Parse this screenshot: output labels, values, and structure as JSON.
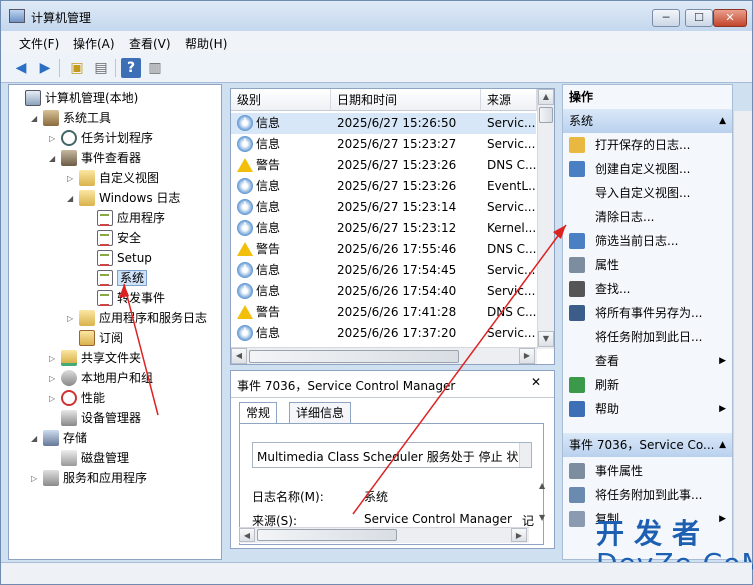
{
  "window": {
    "title": "计算机管理",
    "min": "─",
    "max": "☐",
    "close": "✕"
  },
  "menu": [
    "文件(F)",
    "操作(A)",
    "查看(V)",
    "帮助(H)"
  ],
  "tree": [
    {
      "label": "计算机管理(本地)",
      "indent": 0,
      "exp": "",
      "icon": "computer"
    },
    {
      "label": "系统工具",
      "indent": 1,
      "exp": "◢",
      "icon": "tools"
    },
    {
      "label": "任务计划程序",
      "indent": 2,
      "exp": "▷",
      "icon": "clock"
    },
    {
      "label": "事件查看器",
      "indent": 2,
      "exp": "◢",
      "icon": "event"
    },
    {
      "label": "自定义视图",
      "indent": 3,
      "exp": "▷",
      "icon": "folder"
    },
    {
      "label": "Windows 日志",
      "indent": 3,
      "exp": "◢",
      "icon": "folder"
    },
    {
      "label": "应用程序",
      "indent": 4,
      "exp": "",
      "icon": "log"
    },
    {
      "label": "安全",
      "indent": 4,
      "exp": "",
      "icon": "log"
    },
    {
      "label": "Setup",
      "indent": 4,
      "exp": "",
      "icon": "log"
    },
    {
      "label": "系统",
      "indent": 4,
      "exp": "",
      "icon": "log",
      "selected": true
    },
    {
      "label": "转发事件",
      "indent": 4,
      "exp": "",
      "icon": "log"
    },
    {
      "label": "应用程序和服务日志",
      "indent": 3,
      "exp": "▷",
      "icon": "folder"
    },
    {
      "label": "订阅",
      "indent": 3,
      "exp": "",
      "icon": "subscription"
    },
    {
      "label": "共享文件夹",
      "indent": 2,
      "exp": "▷",
      "icon": "share"
    },
    {
      "label": "本地用户和组",
      "indent": 2,
      "exp": "▷",
      "icon": "users"
    },
    {
      "label": "性能",
      "indent": 2,
      "exp": "▷",
      "icon": "perf"
    },
    {
      "label": "设备管理器",
      "indent": 2,
      "exp": "",
      "icon": "device"
    },
    {
      "label": "存储",
      "indent": 1,
      "exp": "◢",
      "icon": "storage"
    },
    {
      "label": "磁盘管理",
      "indent": 2,
      "exp": "",
      "icon": "disk"
    },
    {
      "label": "服务和应用程序",
      "indent": 1,
      "exp": "▷",
      "icon": "service"
    }
  ],
  "events": {
    "columns": [
      "级别",
      "日期和时间",
      "来源"
    ],
    "rows": [
      {
        "level": "info",
        "level_text": "信息",
        "date": "2025/6/27 15:26:50",
        "source": "Servic...",
        "selected": true
      },
      {
        "level": "info",
        "level_text": "信息",
        "date": "2025/6/27 15:23:27",
        "source": "Servic..."
      },
      {
        "level": "warn",
        "level_text": "警告",
        "date": "2025/6/27 15:23:26",
        "source": "DNS C..."
      },
      {
        "level": "info",
        "level_text": "信息",
        "date": "2025/6/27 15:23:26",
        "source": "EventL..."
      },
      {
        "level": "info",
        "level_text": "信息",
        "date": "2025/6/27 15:23:14",
        "source": "Servic..."
      },
      {
        "level": "info",
        "level_text": "信息",
        "date": "2025/6/27 15:23:12",
        "source": "Kernel..."
      },
      {
        "level": "warn",
        "level_text": "警告",
        "date": "2025/6/26 17:55:46",
        "source": "DNS C..."
      },
      {
        "level": "info",
        "level_text": "信息",
        "date": "2025/6/26 17:54:45",
        "source": "Servic..."
      },
      {
        "level": "info",
        "level_text": "信息",
        "date": "2025/6/26 17:54:40",
        "source": "Servic..."
      },
      {
        "level": "warn",
        "level_text": "警告",
        "date": "2025/6/26 17:41:28",
        "source": "DNS C..."
      },
      {
        "level": "info",
        "level_text": "信息",
        "date": "2025/6/26 17:37:20",
        "source": "Servic..."
      }
    ]
  },
  "detail": {
    "title": "事件 7036，Service Control Manager",
    "close": "✕",
    "tabs": [
      "常规",
      "详细信息"
    ],
    "message": "Multimedia Class Scheduler 服务处于 停止 状态",
    "fields": [
      {
        "label": "日志名称(M):",
        "value": "系统"
      },
      {
        "label": "来源(S):",
        "value": "Service Control Manager"
      }
    ],
    "extra": "记"
  },
  "actions": {
    "header": "操作",
    "section1": "系统",
    "items1": [
      {
        "label": "打开保存的日志...",
        "icon": "open"
      },
      {
        "label": "创建自定义视图...",
        "icon": "filter"
      },
      {
        "label": "导入自定义视图...",
        "icon": ""
      },
      {
        "label": "清除日志...",
        "icon": ""
      },
      {
        "label": "筛选当前日志...",
        "icon": "filter"
      },
      {
        "label": "属性",
        "icon": "props"
      },
      {
        "label": "查找...",
        "icon": "find"
      },
      {
        "label": "将所有事件另存为...",
        "icon": "save"
      },
      {
        "label": "将任务附加到此日...",
        "icon": ""
      },
      {
        "label": "查看",
        "icon": "",
        "submenu": true
      },
      {
        "label": "刷新",
        "icon": "refresh"
      },
      {
        "label": "帮助",
        "icon": "help",
        "submenu": true
      }
    ],
    "section2": "事件 7036，Service Co...",
    "items2": [
      {
        "label": "事件属性",
        "icon": "props"
      },
      {
        "label": "将任务附加到此事...",
        "icon": "task"
      },
      {
        "label": "复制",
        "icon": "copy",
        "submenu": true
      }
    ]
  },
  "watermark": {
    "line1": "开发者",
    "line2": "DevZe.CoM"
  }
}
